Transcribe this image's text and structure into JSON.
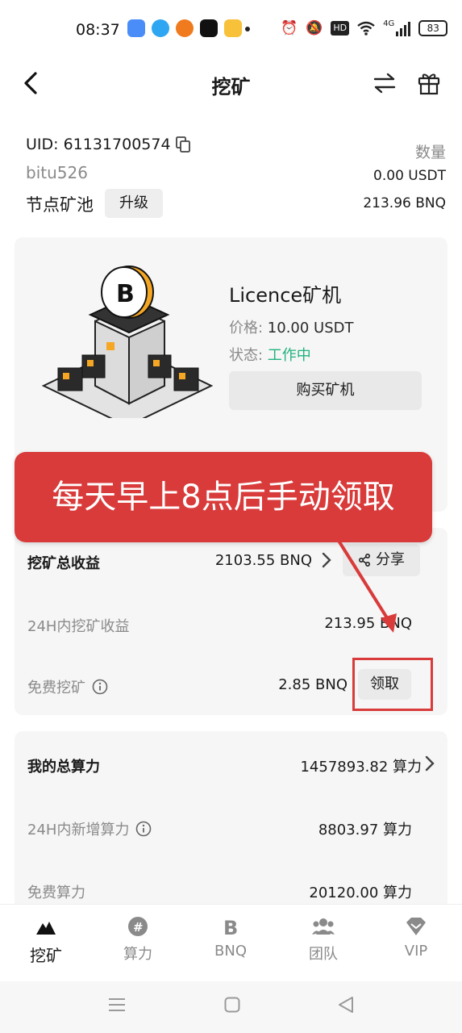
{
  "status_bar": {
    "time": "08:37",
    "hd": "HD",
    "network": "4G",
    "battery": "83"
  },
  "header": {
    "title": "挖矿"
  },
  "account": {
    "uid_label": "UID: 61131700574",
    "username": "bitu526",
    "pool_label": "节点矿池",
    "upgrade_label": "升级",
    "qty_label": "数量",
    "usdt_amount": "0.00 USDT",
    "bnq_amount": "213.96 BNQ"
  },
  "machine": {
    "name": "Licence矿机",
    "price_label": "价格: ",
    "price_value": "10.00 USDT",
    "status_label": "状态: ",
    "status_value": "工作中",
    "buy_label": "购买矿机"
  },
  "banner": {
    "text": "每天早上8点后手动领取"
  },
  "earnings": {
    "total_label": "挖矿总收益",
    "total_value": "2103.55 BNQ",
    "share_label": "分享",
    "h24_label": "24H内挖矿收益",
    "h24_value": "213.95 BNQ",
    "free_label": "免费挖矿",
    "free_value": "2.85 BNQ",
    "claim_label": "领取"
  },
  "hashrate": {
    "total_label": "我的总算力",
    "total_value": "1457893.82 算力",
    "new24_label": "24H内新增算力",
    "new24_value": "8803.97 算力",
    "free_label": "免费算力",
    "free_value": "20120.00 算力"
  },
  "bottom_nav": {
    "items": [
      {
        "label": "挖矿",
        "icon": "mountain-icon"
      },
      {
        "label": "算力",
        "icon": "hashrate-icon"
      },
      {
        "label": "BNQ",
        "icon": "bnq-logo-icon"
      },
      {
        "label": "团队",
        "icon": "team-icon"
      },
      {
        "label": "VIP",
        "icon": "vip-diamond-icon"
      }
    ]
  },
  "colors": {
    "accent_green": "#21b27e",
    "banner_red": "#d93a3a",
    "card_bg": "#f6f6f6"
  }
}
